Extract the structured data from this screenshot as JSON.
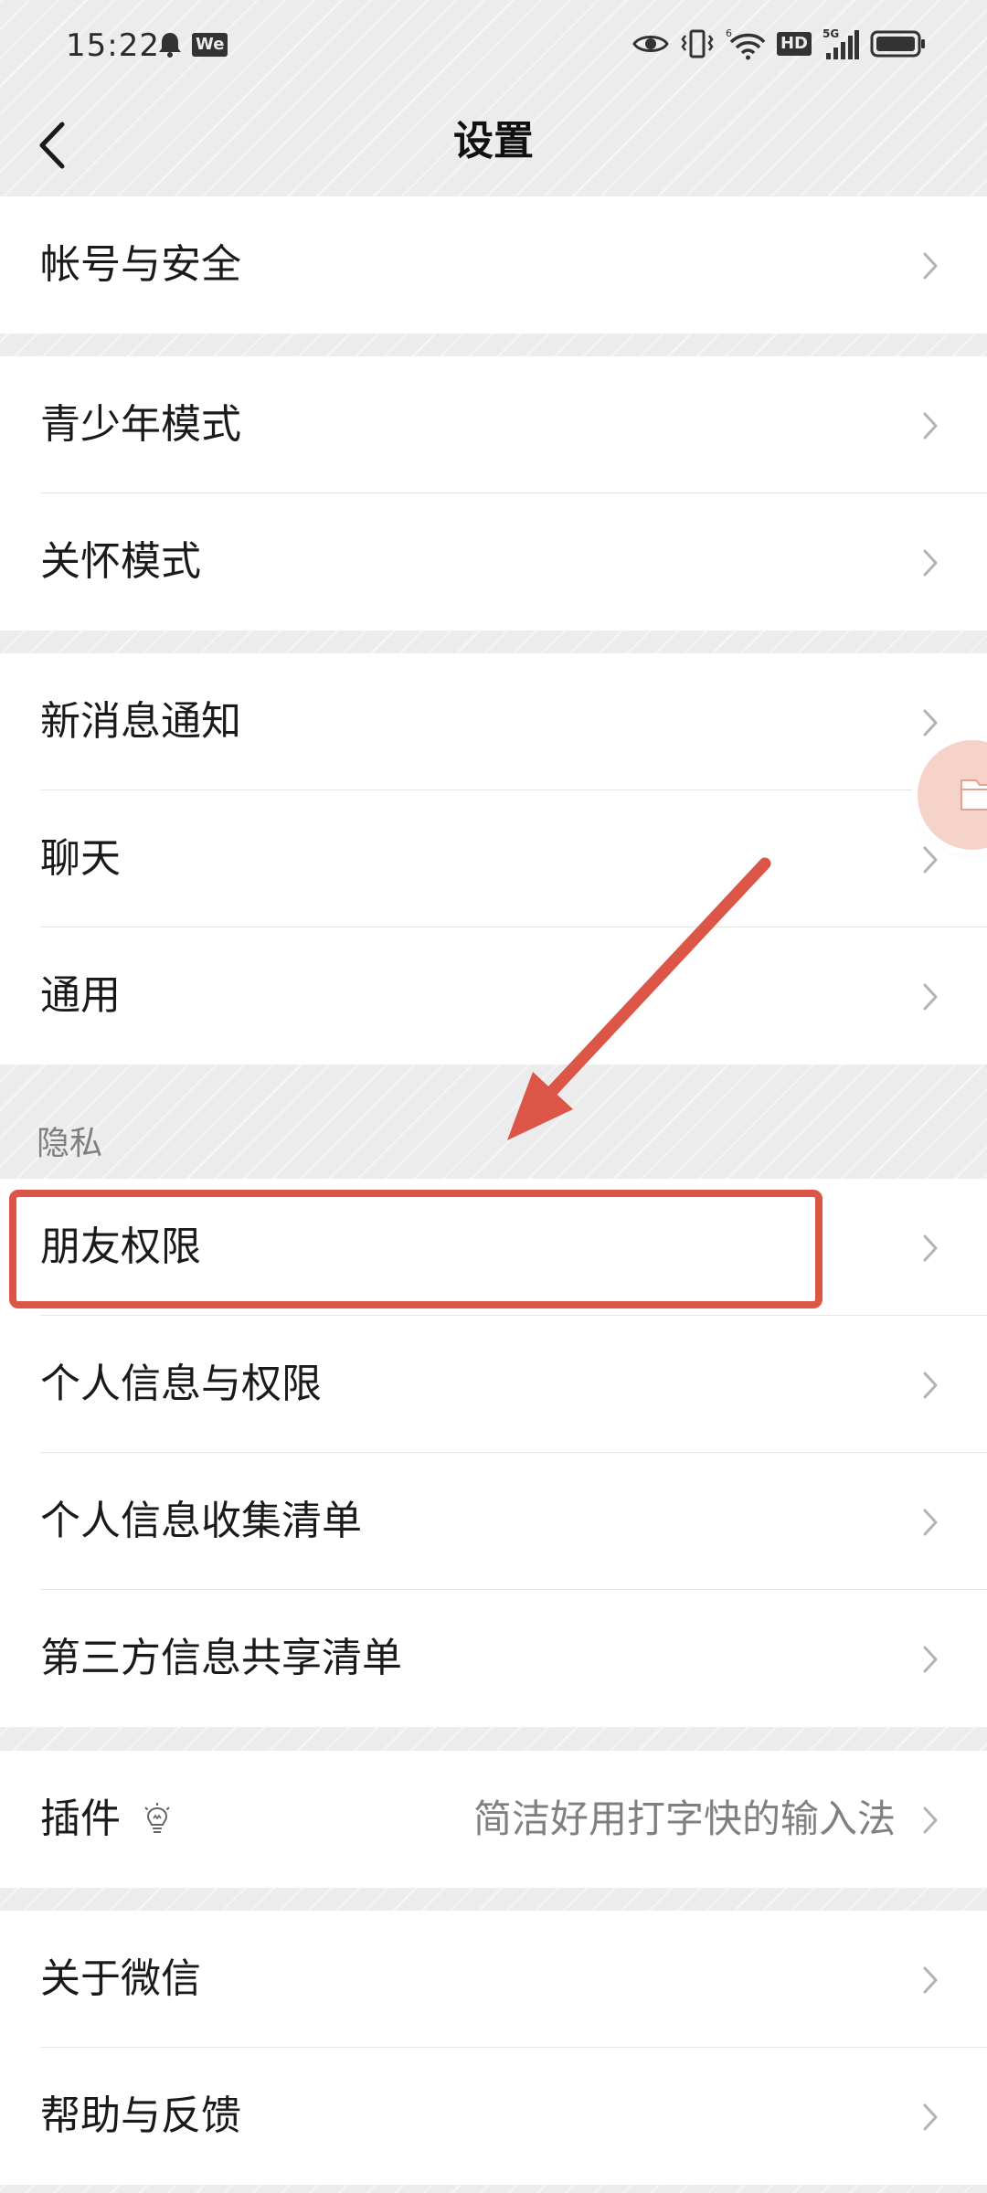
{
  "status_bar": {
    "time": "15:22",
    "left_icons": [
      "bell-icon",
      "wechat-we-badge"
    ],
    "we_badge": "We",
    "right_icons": [
      "eye-icon",
      "vibrate-icon",
      "wifi-icon",
      "hd-badge",
      "signal-5g-icon",
      "battery-icon"
    ],
    "hd_badge": "HD",
    "network": "5G"
  },
  "nav": {
    "title": "设置",
    "back_icon": "chevron-left-icon"
  },
  "groups": {
    "account": {
      "items": [
        {
          "label": "帐号与安全"
        }
      ]
    },
    "modes": {
      "items": [
        {
          "label": "青少年模式"
        },
        {
          "label": "关怀模式"
        }
      ]
    },
    "general": {
      "items": [
        {
          "label": "新消息通知"
        },
        {
          "label": "聊天"
        },
        {
          "label": "通用"
        }
      ]
    },
    "privacy": {
      "section_title": "隐私",
      "items": [
        {
          "label": "朋友权限"
        },
        {
          "label": "个人信息与权限"
        },
        {
          "label": "个人信息收集清单"
        },
        {
          "label": "第三方信息共享清单"
        }
      ]
    },
    "plugins": {
      "items": [
        {
          "label": "插件",
          "value": "简洁好用打字快的输入法",
          "icon": "lightbulb-icon"
        }
      ]
    },
    "about": {
      "items": [
        {
          "label": "关于微信"
        },
        {
          "label": "帮助与反馈"
        }
      ]
    }
  },
  "annotation": {
    "highlight_color": "#db5646",
    "highlighted_item": "朋友权限"
  },
  "colors": {
    "page_background": "#ececec",
    "row_background": "#ffffff",
    "text_primary": "#1a1a1a",
    "text_secondary": "#808080",
    "accent_annotation": "#db5646"
  }
}
